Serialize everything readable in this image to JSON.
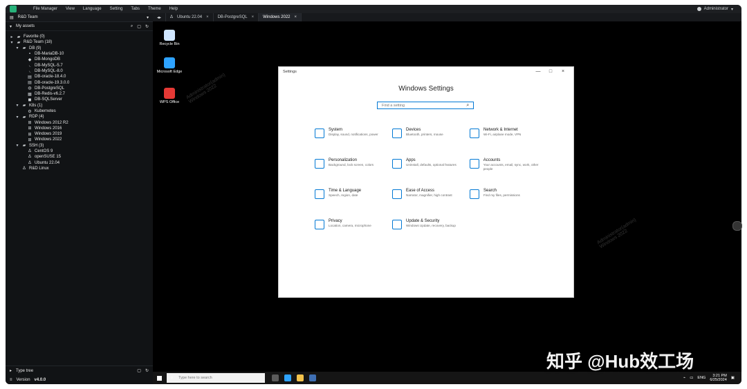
{
  "app": {
    "menu": [
      "File Manager",
      "View",
      "Language",
      "Setting",
      "Tabs",
      "Theme",
      "Help"
    ],
    "user": "Administrator",
    "tabs": [
      {
        "label": "Ubuntu 22.04",
        "active": false
      },
      {
        "label": "DB-PostgreSQL",
        "active": false
      },
      {
        "label": "Windows 2022",
        "active": true
      }
    ]
  },
  "sidebar": {
    "team": "R&D Team",
    "my_assets": "My assets",
    "tree": [
      {
        "label": "Favorite (0)",
        "level": 1,
        "caret": "▸",
        "icon": "▰"
      },
      {
        "label": "R&D Team (18)",
        "level": 1,
        "caret": "▾",
        "icon": "▰"
      },
      {
        "label": "DB (9)",
        "level": 2,
        "caret": "▾",
        "icon": "▰"
      },
      {
        "label": "DB-MariaDB-10",
        "level": 3,
        "caret": "",
        "icon": "▪"
      },
      {
        "label": "DB-MongoDB",
        "level": 3,
        "caret": "",
        "icon": "◆"
      },
      {
        "label": "DB-MySQL-5.7",
        "level": 3,
        "caret": "",
        "icon": "◟"
      },
      {
        "label": "DB-MySQL-8.0",
        "level": 3,
        "caret": "",
        "icon": "◟"
      },
      {
        "label": "DB-oracle-18.4.0",
        "level": 3,
        "caret": "",
        "icon": "▤"
      },
      {
        "label": "DB-oracle-19.3.0.0",
        "level": 3,
        "caret": "",
        "icon": "▤"
      },
      {
        "label": "DB-PostgreSQL",
        "level": 3,
        "caret": "",
        "icon": "◍"
      },
      {
        "label": "DB-Redis-v6.2.7",
        "level": 3,
        "caret": "",
        "icon": "▦"
      },
      {
        "label": "DB-SQLServer",
        "level": 3,
        "caret": "",
        "icon": "◼"
      },
      {
        "label": "K8s (1)",
        "level": 2,
        "caret": "▾",
        "icon": "▰"
      },
      {
        "label": "Kubernetes",
        "level": 3,
        "caret": "",
        "icon": "⚙"
      },
      {
        "label": "RDP (4)",
        "level": 2,
        "caret": "▾",
        "icon": "▰"
      },
      {
        "label": "Windows 2012 R2",
        "level": 3,
        "caret": "",
        "icon": "⊞"
      },
      {
        "label": "Windows 2016",
        "level": 3,
        "caret": "",
        "icon": "⊞"
      },
      {
        "label": "Windows 2019",
        "level": 3,
        "caret": "",
        "icon": "⊞"
      },
      {
        "label": "Windows 2022",
        "level": 3,
        "caret": "",
        "icon": "⊞"
      },
      {
        "label": "SSH (3)",
        "level": 2,
        "caret": "▾",
        "icon": "▰"
      },
      {
        "label": "CentOS 9",
        "level": 3,
        "caret": "",
        "icon": "Δ"
      },
      {
        "label": "openSUSE 15",
        "level": 3,
        "caret": "",
        "icon": "Δ"
      },
      {
        "label": "Ubuntu 22.04",
        "level": 3,
        "caret": "",
        "icon": "Δ"
      },
      {
        "label": "R&D Linux",
        "level": 2,
        "caret": "",
        "icon": "Δ"
      }
    ],
    "type_tree": "Type tree",
    "version_label": "Version",
    "version": "v4.0.0"
  },
  "desktop": {
    "icons": [
      "Recycle Bin",
      "Microsoft Edge",
      "WPS Office"
    ],
    "watermark_line1": "Administrator(admin)",
    "watermark_line2": "Windows 2022"
  },
  "settings": {
    "title": "Settings",
    "heading": "Windows Settings",
    "search_placeholder": "Find a setting",
    "items": [
      {
        "title": "System",
        "desc": "Display, sound, notifications, power"
      },
      {
        "title": "Devices",
        "desc": "Bluetooth, printers, mouse"
      },
      {
        "title": "Network & Internet",
        "desc": "Wi-Fi, airplane mode, VPN"
      },
      {
        "title": "Personalization",
        "desc": "Background, lock screen, colors"
      },
      {
        "title": "Apps",
        "desc": "Uninstall, defaults, optional features"
      },
      {
        "title": "Accounts",
        "desc": "Your accounts, email, sync, work, other people"
      },
      {
        "title": "Time & Language",
        "desc": "Speech, region, date"
      },
      {
        "title": "Ease of Access",
        "desc": "Narrator, magnifier, high contrast"
      },
      {
        "title": "Search",
        "desc": "Find my files, permissions"
      },
      {
        "title": "Privacy",
        "desc": "Location, camera, microphone"
      },
      {
        "title": "Update & Security",
        "desc": "Windows Update, recovery, backup"
      }
    ]
  },
  "taskbar": {
    "search_placeholder": "Type here to search",
    "lang": "ENG",
    "time": "3:21 PM",
    "date": "6/25/2024"
  },
  "brand_watermark": "知乎 @Hub效工场"
}
